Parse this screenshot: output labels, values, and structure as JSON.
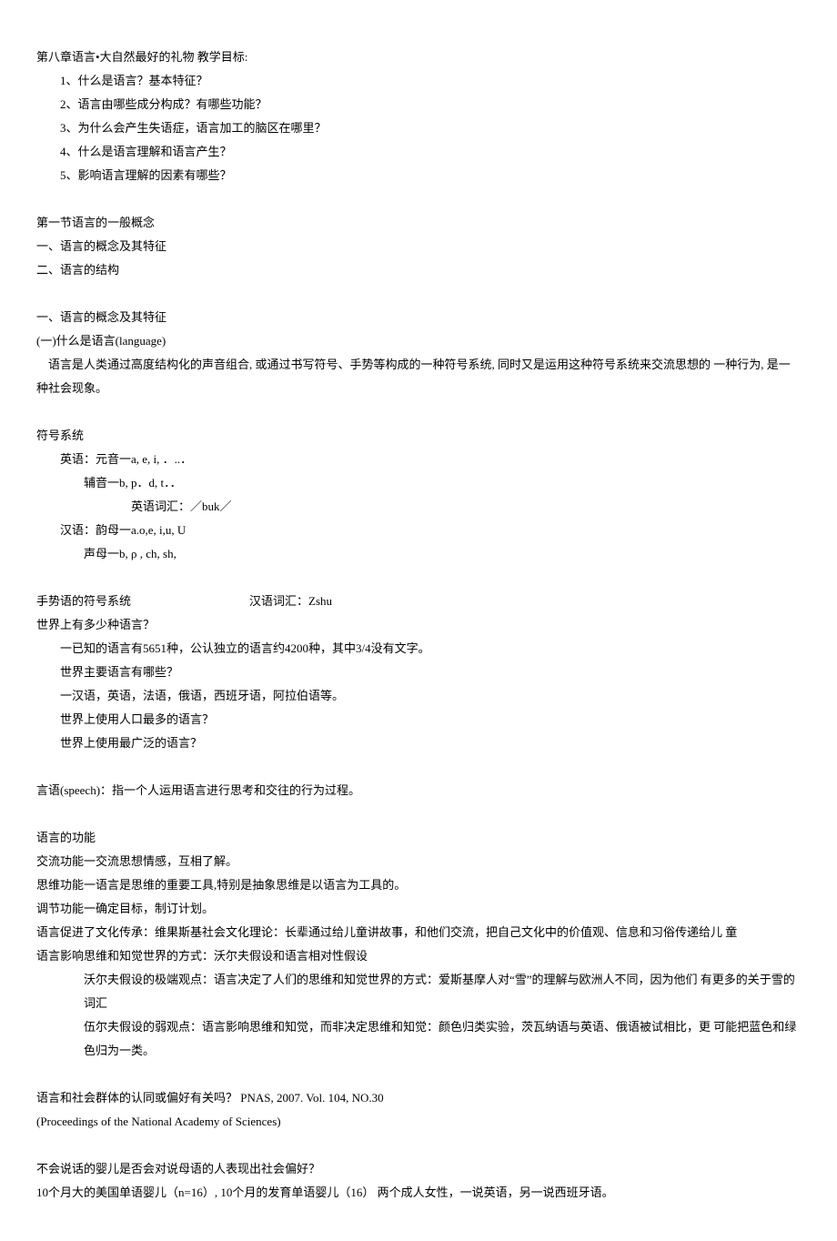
{
  "title": "第八章语言•大自然最好的礼物 教学目标:",
  "objectives": [
    "1、什么是语言？基本特征？",
    "2、语言由哪些成分构成？有哪些功能？",
    "3、为什么会产生失语症，语言加工的脑区在哪里？",
    "4、什么是语言理解和语言产生？",
    "5、影响语言理解的因素有哪些？"
  ],
  "section1": {
    "heading": "第一节语言的一般概念",
    "sub1": "一、语言的概念及其特征",
    "sub2": "二、语言的结构"
  },
  "concept": {
    "heading": "一、语言的概念及其特征",
    "sub": "(一)什么是语言(language)",
    "def": "语言是人类通过高度结构化的声音组合, 或通过书写符号、手势等构成的一种符号系统, 同时又是运用这种符号系统来交流思想的 一种行为, 是一种社会现象。"
  },
  "symbol_system": {
    "heading": "符号系统",
    "lines": [
      "英语：元音一a, e, i, ．..．",
      "辅音一b, p．d, t．．",
      "英语词汇：／buk／",
      "汉语：韵母一a.o,e, i,u, U",
      "声母一b, ρ , ch, sh,"
    ]
  },
  "gesture": {
    "left": "手势语的符号系统",
    "right": "汉语词汇：Zshu"
  },
  "languages": {
    "q1": "世界上有多少种语言？",
    "a1": "一已知的语言有5651种，公认独立的语言约4200种，其中3/4没有文字。",
    "q2": "世界主要语言有哪些？",
    "a2": "一汉语，英语，法语，俄语，西班牙语，阿拉伯语等。",
    "q3": "世界上使用人口最多的语言？",
    "q4": "世界上使用最广泛的语言？"
  },
  "speech": "言语(speech)：指一个人运用语言进行思考和交往的行为过程。",
  "functions": {
    "heading": "语言的功能",
    "f1": "交流功能一交流思想情感，互相了解。",
    "f2": "思维功能一语言是思维的重要工具,特别是抽象思维是以语言为工具的。",
    "f3": "调节功能一确定目标，制订计划。",
    "f4": "语言促进了文化传承：维果斯基社会文化理论：长辈通过给儿童讲故事，和他们交流，把自己文化中的价值观、信息和习俗传递给儿 童",
    "f5": "语言影响思维和知觉世界的方式：沃尔夫假设和语言相对性假设",
    "f5a": "沃尔夫假设的极端观点：语言决定了人们的思维和知觉世界的方式：爱斯基摩人对“雪”的理解与欧洲人不同，因为他们 有更多的关于雪的词汇",
    "f5a_cont": "的关于雪的词汇",
    "f5b": "伍尔夫假设的弱观点：语言影响思维和知觉，而非决定思维和知觉：颜色归类实验，茨瓦纳语与英语、俄语被试相比，更 可能把蓝色和绿色归为一类。",
    "f5b_cont": "蓝色和绿色归为一类。"
  },
  "study": {
    "q": "语言和社会群体的认同或偏好有关吗？ PNAS, 2007. Vol. 104, NO.30",
    "ref": "(Proceedings of the National Academy of Sciences)"
  },
  "infant": {
    "q": "不会说话的婴儿是否会对说母语的人表现出社会偏好？",
    "exp": "10个月大的美国单语婴儿（n=16）, 10个月的发育单语婴儿（16） 两个成人女性，一说英语，另一说西班牙语。"
  }
}
